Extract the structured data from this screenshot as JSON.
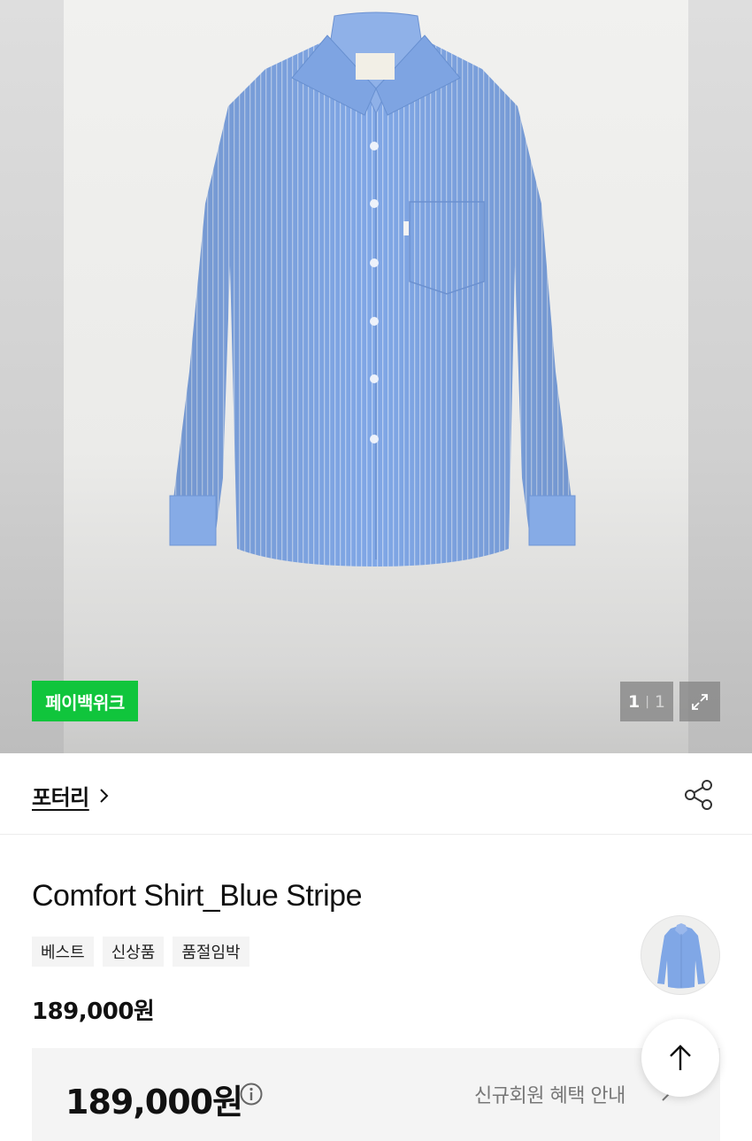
{
  "gallery": {
    "badge": "페이백위크",
    "pager": {
      "current": "1",
      "separator": "|",
      "total": "1"
    },
    "icons": {
      "expand": "expand-icon"
    }
  },
  "brand": {
    "name": "포터리",
    "chevron": "›",
    "icons": {
      "share": "share-icon",
      "chevron": "chevron-right-icon"
    }
  },
  "product": {
    "title": "Comfort Shirt_Blue Stripe",
    "tags": [
      "베스트",
      "신상품",
      "품절임박"
    ],
    "price": "189,000원"
  },
  "benefit": {
    "price": "189,000원",
    "link": "신규회원 혜택 안내",
    "icons": {
      "info": "info-icon",
      "chevron": "chevron-right-icon"
    }
  },
  "scroll_top": {
    "icon": "arrow-up-icon"
  },
  "colors": {
    "pay_badge": "#10c53c",
    "shirt": "#7fa6e4",
    "text": "#111111",
    "muted": "#777777",
    "box_bg": "#f4f4f4"
  }
}
